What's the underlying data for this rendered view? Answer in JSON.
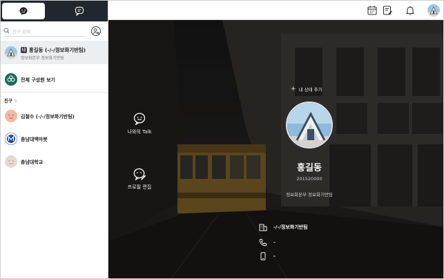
{
  "tabs": [
    {
      "icon": "chat-bubble-smile-icon",
      "active": true
    },
    {
      "icon": "chat-list-icon",
      "active": false
    }
  ],
  "search": {
    "placeholder": "친구 검색"
  },
  "me": {
    "badge": "나",
    "name": "홍길동 (-/-/정보화기반팀)",
    "dept": "정보화본부 정보화기반팀"
  },
  "all_members": {
    "label": "전체 구성원 보기"
  },
  "friends_section": {
    "label": "친구",
    "count": "3"
  },
  "friends": [
    {
      "name": "김철수 (-/-/정보화기반팀)",
      "avatar_color": "#f0b8a8"
    },
    {
      "name": "충남대백마봇",
      "avatar_color": "#1f4f9c"
    },
    {
      "name": "충남대학교",
      "avatar_color": "#e6d9cf"
    }
  ],
  "topbar_icons": [
    "calendar-icon",
    "note-icon",
    "bell-icon",
    "profile-avatar"
  ],
  "profile": {
    "talk_label": "나와의 Talk",
    "edit_label": "프로필 편집",
    "status_add": "내 상태 추가",
    "name": "홍길동",
    "id": "201520000",
    "dept": "정보화본부 정보화기반팀",
    "team": "-/-/정보화기반팀",
    "phone": "-",
    "mobile": "-"
  },
  "colors": {
    "sidebar_tabbar": "#20272e",
    "selected_row": "#eceef0",
    "all_members_icon": "#1e6b5a"
  }
}
